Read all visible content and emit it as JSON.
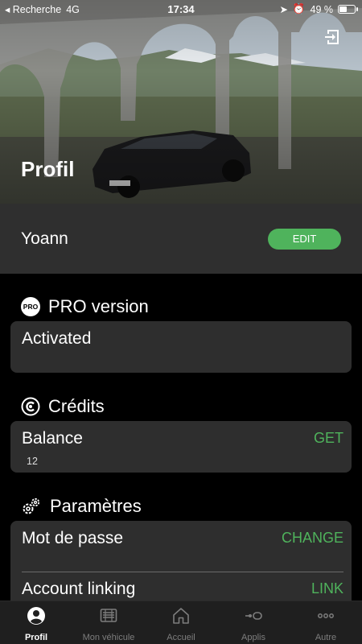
{
  "status_bar": {
    "carrier": "◂ Recherche",
    "network": "4G",
    "time": "17:34",
    "battery": "49 %",
    "battery_level": 0.49
  },
  "header": {
    "title": "Profil",
    "logout_icon": "logout-icon"
  },
  "user": {
    "name": "Yoann",
    "edit_label": "EDIT"
  },
  "pro": {
    "badge": "PRO",
    "heading": "PRO version",
    "status": "Activated"
  },
  "credits": {
    "heading": "Crédits",
    "balance_label": "Balance",
    "balance_value": "12",
    "get_label": "GET"
  },
  "settings": {
    "heading": "Paramètres",
    "password_label": "Mot de passe",
    "password_action": "CHANGE",
    "linking_label": "Account linking",
    "linking_action": "LINK"
  },
  "tabs": [
    {
      "label": "Profil",
      "icon": "profile-icon",
      "active": true
    },
    {
      "label": "Mon véhicule",
      "icon": "vehicle-icon",
      "active": false
    },
    {
      "label": "Accueil",
      "icon": "home-icon",
      "active": false
    },
    {
      "label": "Applis",
      "icon": "apps-icon",
      "active": false
    },
    {
      "label": "Autre",
      "icon": "more-icon",
      "active": false
    }
  ],
  "colors": {
    "accent": "#4fb35c",
    "card": "#2e2e2e",
    "background": "#000000"
  }
}
